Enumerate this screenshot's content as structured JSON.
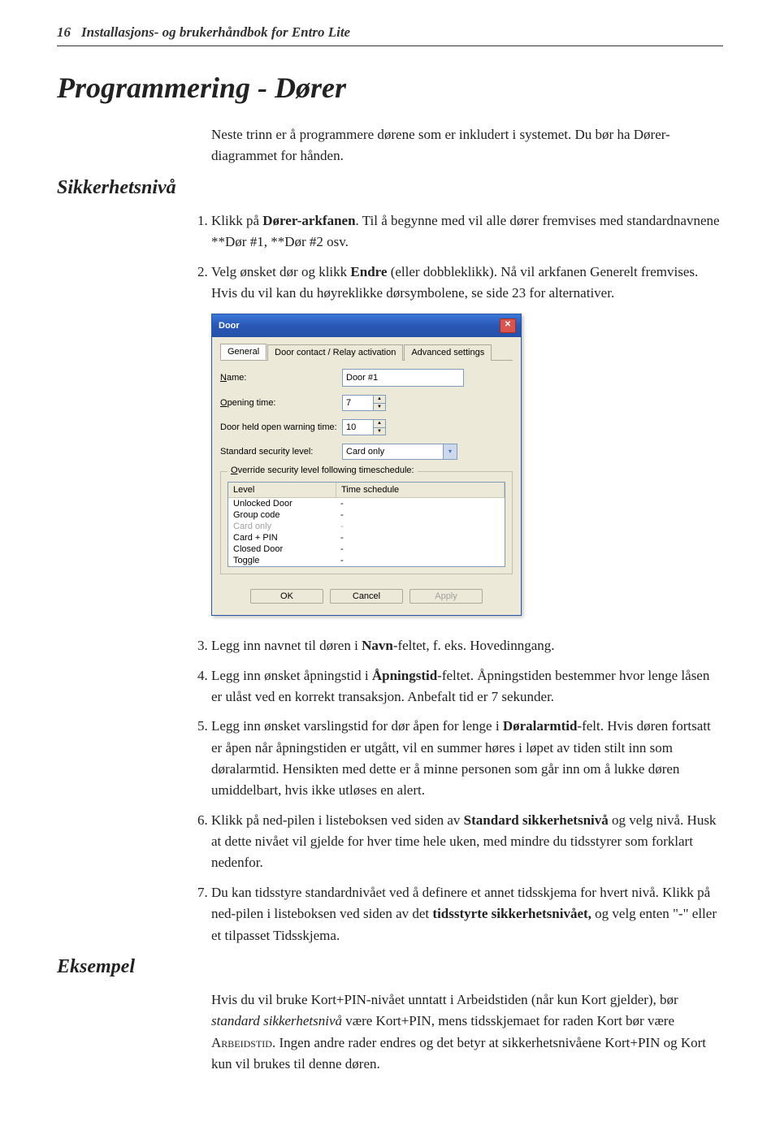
{
  "header": {
    "page_num": "16",
    "running_title": "Installasjons- og brukerhåndbok for Entro Lite"
  },
  "title": "Programmering - Dører",
  "intro": "Neste trinn er å programmere dørene som er inkludert i systemet. Du bør ha Dører-diagrammet for hånden.",
  "section1": {
    "heading": "Sikkerhetsnivå",
    "step1_a": "Klikk på ",
    "step1_b": "Dører-arkfanen",
    "step1_c": ". Til å begynne med vil alle dører fremvises med standardnavnene **Dør #1, **Dør #2 osv.",
    "step2_a": "Velg ønsket dør og klikk ",
    "step2_b": "Endre",
    "step2_c": " (eller dobbleklikk). Nå vil arkfanen Generelt fremvises. Hvis du vil kan du høyreklikke dørsymbolene, se side 23 for alternativer."
  },
  "dialog": {
    "title": "Door",
    "close_glyph": "✕",
    "tabs": {
      "general": "General",
      "contact": "Door contact / Relay activation",
      "advanced": "Advanced settings"
    },
    "labels": {
      "name": "Name:",
      "opening": "Opening time:",
      "warning": "Door held open warning time:",
      "seclevel": "Standard security level:"
    },
    "values": {
      "name": "Door #1",
      "opening": "7",
      "warning": "10",
      "seclevel": "Card only"
    },
    "group": {
      "title": "Override security level following timeschedule:",
      "col1": "Level",
      "col2": "Time schedule",
      "rows": [
        {
          "level": "Unlocked Door",
          "ts": "-",
          "dim": false
        },
        {
          "level": "Group code",
          "ts": "-",
          "dim": false
        },
        {
          "level": "Card only",
          "ts": "-",
          "dim": true
        },
        {
          "level": "Card + PIN",
          "ts": "-",
          "dim": false
        },
        {
          "level": "Closed Door",
          "ts": "-",
          "dim": false
        },
        {
          "level": "Toggle",
          "ts": "-",
          "dim": false
        }
      ]
    },
    "buttons": {
      "ok": "OK",
      "cancel": "Cancel",
      "apply": "Apply"
    }
  },
  "steps2": {
    "s3_a": "Legg inn navnet til døren i ",
    "s3_b": "Navn",
    "s3_c": "-feltet, f. eks. Hovedinngang.",
    "s4_a": "Legg inn ønsket åpningstid i ",
    "s4_b": "Åpningstid",
    "s4_c": "-feltet. Åpningstiden bestemmer hvor lenge låsen er ulåst ved en korrekt transaksjon. Anbefalt tid er 7 sekunder.",
    "s5_a": "Legg inn ønsket varslingstid for dør åpen for lenge i ",
    "s5_b": "Døralarmtid",
    "s5_c": "-felt. Hvis døren fortsatt er åpen når åpningstiden er utgått, vil en summer høres i løpet av tiden stilt inn som døralarmtid. Hensikten med dette er å minne personen som går inn om å lukke døren umiddelbart, hvis ikke utløses en alert.",
    "s6_a": "Klikk på ned-pilen i listeboksen ved siden av ",
    "s6_b": "Standard sikkerhetsnivå",
    "s6_c": " og velg nivå. Husk at dette nivået vil gjelde for hver time hele uken, med mindre du tidsstyrer som forklart nedenfor.",
    "s7_a": "Du kan tidsstyre standardnivået ved å definere et annet tidsskjema for hvert nivå. Klikk på ned-pilen i listeboksen ved siden av det ",
    "s7_b": "tidsstyrte sikkerhetsnivået,",
    "s7_c": " og velg enten \"-\" eller et tilpasset Tidsskjema."
  },
  "example": {
    "heading": "Eksempel",
    "text_a": "Hvis du vil bruke Kort+PIN-nivået unntatt i Arbeidstiden (når kun Kort gjelder), bør ",
    "text_b": "standard sikkerhetsnivå",
    "text_c": " være Kort+PIN, mens tidsskjemaet for raden Kort bør være ",
    "text_d": "Arbeidstid",
    "text_e": ". Ingen andre rader endres og det betyr at sikkerhetsnivåene Kort+PIN og Kort kun vil brukes til denne døren."
  }
}
